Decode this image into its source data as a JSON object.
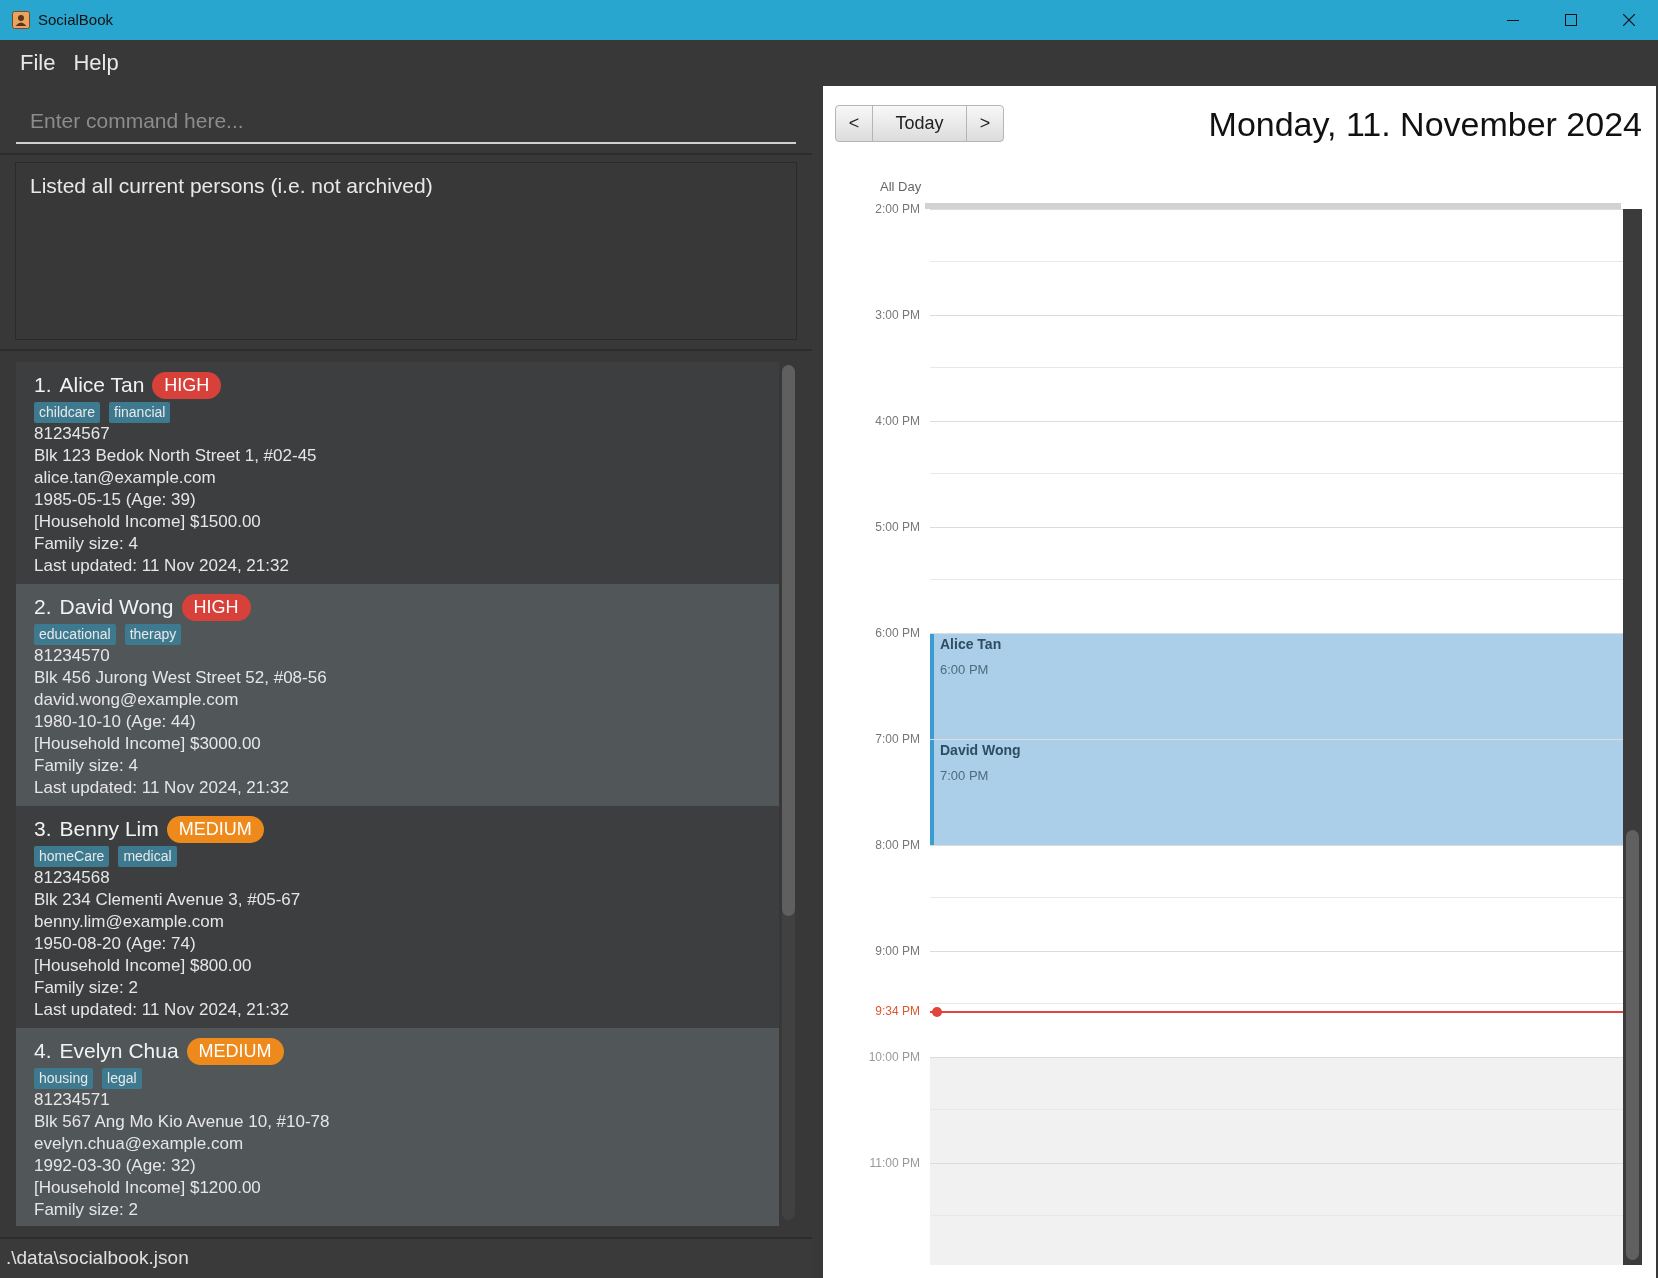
{
  "window": {
    "title": "SocialBook"
  },
  "menu": [
    {
      "label": "File"
    },
    {
      "label": "Help"
    }
  ],
  "command_box": {
    "placeholder": "Enter command here..."
  },
  "result_display": {
    "text": "Listed all current persons (i.e. not archived)"
  },
  "persons": [
    {
      "index": "1.",
      "name": "Alice Tan",
      "priority": {
        "label": "HIGH",
        "color": "#d8413a"
      },
      "tags": [
        "childcare",
        "financial"
      ],
      "phone": "81234567",
      "address": "Blk 123 Bedok North Street 1, #02-45",
      "email": "alice.tan@example.com",
      "birthday": "1985-05-15 (Age: 39)",
      "income": "[Household Income] $1500.00",
      "family_size": "Family size: 4",
      "last_updated": "Last updated: 11 Nov 2024, 21:32"
    },
    {
      "index": "2.",
      "name": "David Wong",
      "priority": {
        "label": "HIGH",
        "color": "#d8413a"
      },
      "tags": [
        "educational",
        "therapy"
      ],
      "phone": "81234570",
      "address": "Blk 456 Jurong West Street 52, #08-56",
      "email": "david.wong@example.com",
      "birthday": "1980-10-10 (Age: 44)",
      "income": "[Household Income] $3000.00",
      "family_size": "Family size: 4",
      "last_updated": "Last updated: 11 Nov 2024, 21:32"
    },
    {
      "index": "3.",
      "name": "Benny Lim",
      "priority": {
        "label": "MEDIUM",
        "color": "#ee8a1b"
      },
      "tags": [
        "homeCare",
        "medical"
      ],
      "phone": "81234568",
      "address": "Blk 234 Clementi Avenue 3, #05-67",
      "email": "benny.lim@example.com",
      "birthday": "1950-08-20 (Age: 74)",
      "income": "[Household Income] $800.00",
      "family_size": "Family size: 2",
      "last_updated": "Last updated: 11 Nov 2024, 21:32"
    },
    {
      "index": "4.",
      "name": "Evelyn Chua",
      "priority": {
        "label": "MEDIUM",
        "color": "#ee8a1b"
      },
      "tags": [
        "housing",
        "legal"
      ],
      "phone": "81234571",
      "address": "Blk 567 Ang Mo Kio Avenue 10, #10-78",
      "email": "evelyn.chua@example.com",
      "birthday": "1992-03-30 (Age: 32)",
      "income": "[Household Income] $1200.00",
      "family_size": "Family size: 2"
    }
  ],
  "status_bar": {
    "path": ".\\data\\socialbook.json"
  },
  "calendar": {
    "nav_buttons": [
      "<",
      "Today",
      ">"
    ],
    "date_title": "Monday, 11. November 2024",
    "all_day_label": "All Day",
    "hours": [
      {
        "label": "2:00 PM",
        "kind": "regular"
      },
      {
        "label": "3:00 PM",
        "kind": "regular"
      },
      {
        "label": "4:00 PM",
        "kind": "regular"
      },
      {
        "label": "5:00 PM",
        "kind": "regular"
      },
      {
        "label": "6:00 PM",
        "kind": "regular",
        "events": [
          {
            "title": "Alice Tan",
            "time": "6:00 PM"
          }
        ]
      },
      {
        "label": "7:00 PM",
        "kind": "regular",
        "events": [
          {
            "title": "David Wong",
            "time": "7:00 PM"
          }
        ]
      },
      {
        "label": "8:00 PM",
        "kind": "regular"
      },
      {
        "label": "9:00 PM",
        "kind": "regular",
        "now": {
          "label": "9:34 PM"
        }
      },
      {
        "label": "10:00 PM",
        "kind": "off"
      },
      {
        "label": "11:00 PM",
        "kind": "off"
      }
    ]
  }
}
